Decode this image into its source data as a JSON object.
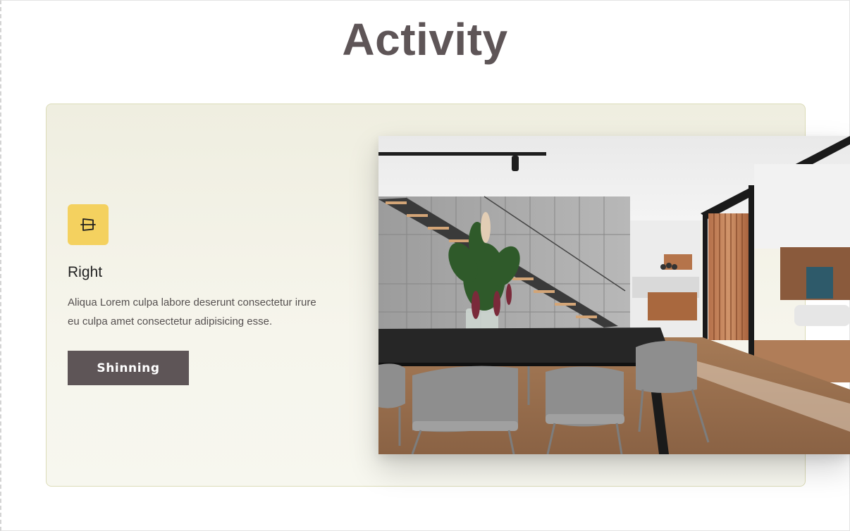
{
  "page": {
    "title": "Activity"
  },
  "feature": {
    "icon": "scanner-frame-icon",
    "title": "Right",
    "description": "Aliqua Lorem culpa labore deserunt consectetur irure eu culpa amet consectetur adipisicing esse.",
    "button_label": "Shinning"
  },
  "image": {
    "subject": "interior-dining-room-photo"
  },
  "colors": {
    "title": "#5e5557",
    "card_background": "#f3f2e6",
    "card_border": "#dcdcb8",
    "icon_background": "#f4d15f",
    "button_background": "#5e5557",
    "button_text": "#ffffff"
  }
}
